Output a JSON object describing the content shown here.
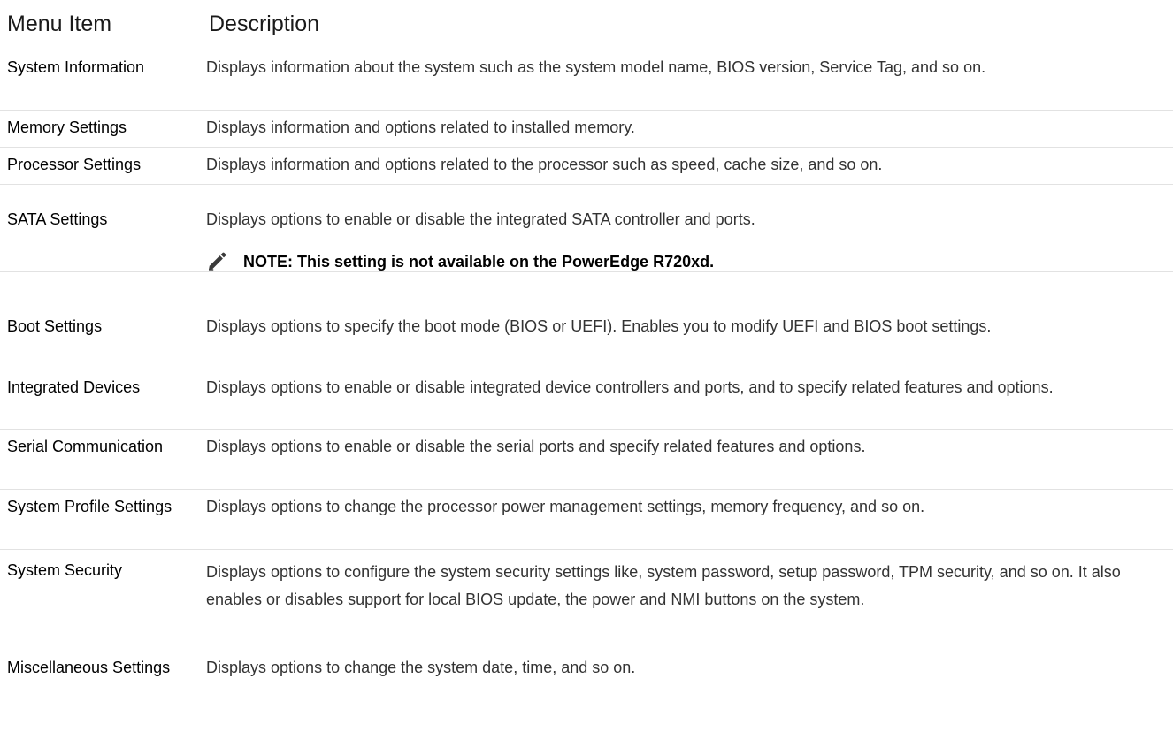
{
  "table": {
    "headers": {
      "menu_item": "Menu Item",
      "description": "Description"
    },
    "rows": [
      {
        "label": "System Information",
        "description": "Displays information about the system such as the system model name, BIOS version, Service Tag, and so on."
      },
      {
        "label": "Memory Settings",
        "description": "Displays information and options related to installed memory."
      },
      {
        "label": "Processor Settings",
        "description": "Displays information and options related to the processor such as speed, cache size, and so on."
      },
      {
        "label": "SATA Settings",
        "description": "Displays options to enable or disable the integrated SATA controller and ports.",
        "note": "NOTE: This setting is not available on the PowerEdge R720xd.",
        "note_icon": "pencil-note-icon"
      },
      {
        "label": "Boot Settings",
        "description": "Displays options to specify the boot mode (BIOS or UEFI). Enables you to modify UEFI and BIOS boot settings."
      },
      {
        "label": "Integrated Devices",
        "description": "Displays options to enable or disable integrated device controllers and ports, and to specify related features and options."
      },
      {
        "label": "Serial Communication",
        "description": "Displays options to enable or disable the serial ports and specify related features and options."
      },
      {
        "label": "System Profile Settings",
        "description": "Displays options to change the processor power management settings, memory frequency, and so on."
      },
      {
        "label": "System Security",
        "description": "Displays options to configure the system security settings like, system password, setup password, TPM security, and so on. It also enables or disables support for local BIOS update, the power and NMI buttons on the system."
      },
      {
        "label": "Miscellaneous Settings",
        "description": "Displays options to change the system date, time, and so on."
      }
    ]
  }
}
